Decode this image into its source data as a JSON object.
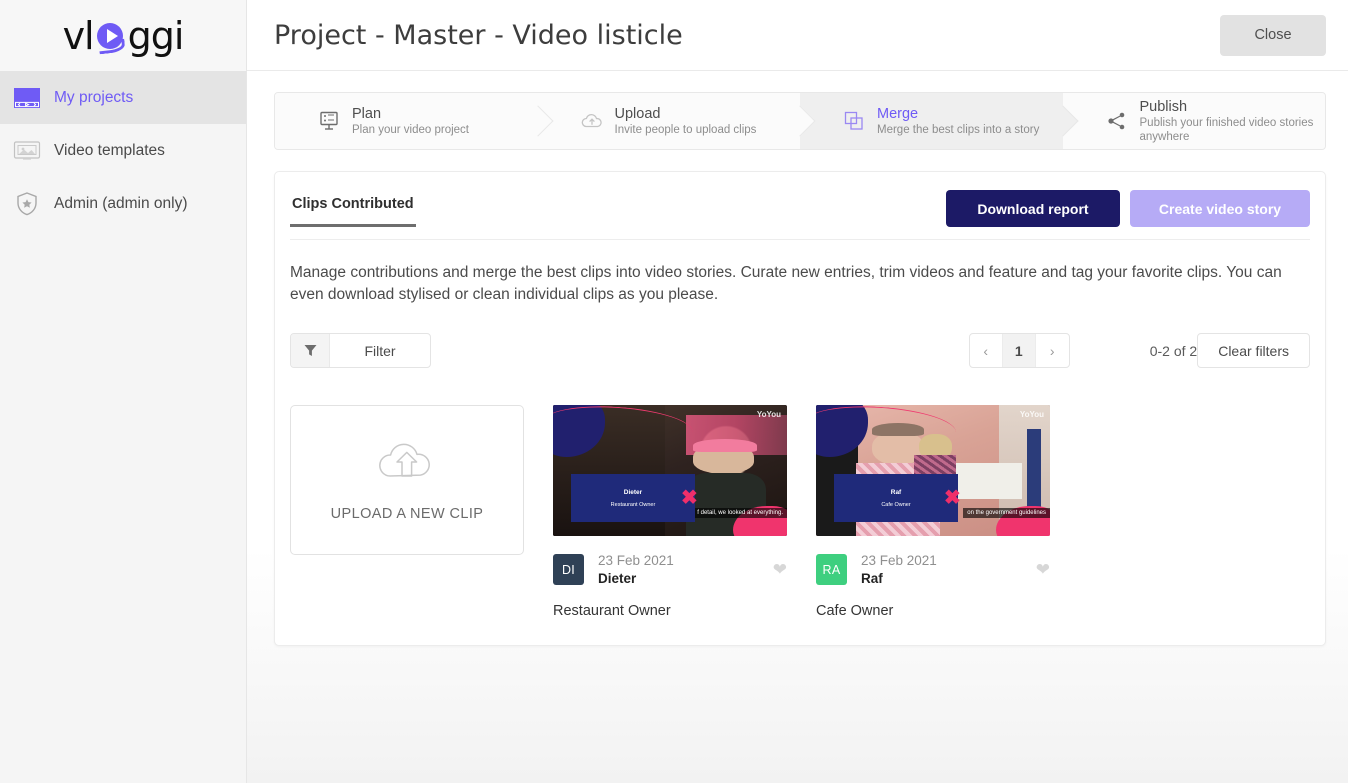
{
  "brand": {
    "logo_text_left": "vl",
    "logo_mark": "play-circle",
    "logo_text_right": "ggi",
    "accent_purple": "#6f5bf5",
    "navy": "#1c1a66",
    "light_purple": "#b6abf6"
  },
  "sidebar": {
    "items": [
      {
        "label": "My projects",
        "icon": "video-screen-icon",
        "active": true
      },
      {
        "label": "Video templates",
        "icon": "template-image-icon",
        "active": false
      },
      {
        "label": "Admin (admin only)",
        "icon": "shield-star-icon",
        "active": false
      }
    ]
  },
  "header": {
    "title": "Project - Master - Video listicle",
    "close_label": "Close"
  },
  "stepper": {
    "steps": [
      {
        "name": "Plan",
        "desc": "Plan your video project",
        "icon": "presentation-board-icon",
        "active": false
      },
      {
        "name": "Upload",
        "desc": "Invite people to upload clips",
        "icon": "cloud-upload-icon",
        "active": false
      },
      {
        "name": "Merge",
        "desc": "Merge the best clips into a story",
        "icon": "overlapping-squares-icon",
        "active": true
      },
      {
        "name": "Publish",
        "desc": "Publish your finished video stories anywhere",
        "icon": "share-nodes-icon",
        "active": false
      }
    ]
  },
  "panel": {
    "tabs": [
      {
        "label": "Clips Contributed",
        "active": true
      }
    ],
    "download_report_label": "Download report",
    "create_story_label": "Create video story",
    "description": "Manage contributions and merge the best clips into video stories. Curate new entries, trim videos and feature and tag your favorite clips. You can even download stylised or clean individual clips as you please.",
    "filter_label": "Filter",
    "filter_icon": "funnel-icon",
    "pagination": {
      "prev": "‹",
      "current": "1",
      "next": "›",
      "count_text": "0-2 of 2"
    },
    "clear_filters_label": "Clear filters",
    "upload_card": {
      "label": "UPLOAD A NEW CLIP",
      "icon": "cloud-upload-icon"
    },
    "clips": [
      {
        "initials": "DI",
        "avatar_color": "#2f4156",
        "date": "23 Feb 2021",
        "name": "Dieter",
        "role": "Restaurant Owner",
        "overlay_name": "Dieter",
        "overlay_role": "Restaurant Owner",
        "caption": "f detail, we looked at everything.",
        "watermark": "YoYou",
        "favorite": false
      },
      {
        "initials": "RA",
        "avatar_color": "#3ecf7f",
        "date": "23 Feb 2021",
        "name": "Raf",
        "role": "Cafe Owner",
        "overlay_name": "Raf",
        "overlay_role": "Cafe Owner",
        "caption": "on the government guidelines",
        "watermark": "YoYou",
        "favorite": false
      }
    ]
  }
}
